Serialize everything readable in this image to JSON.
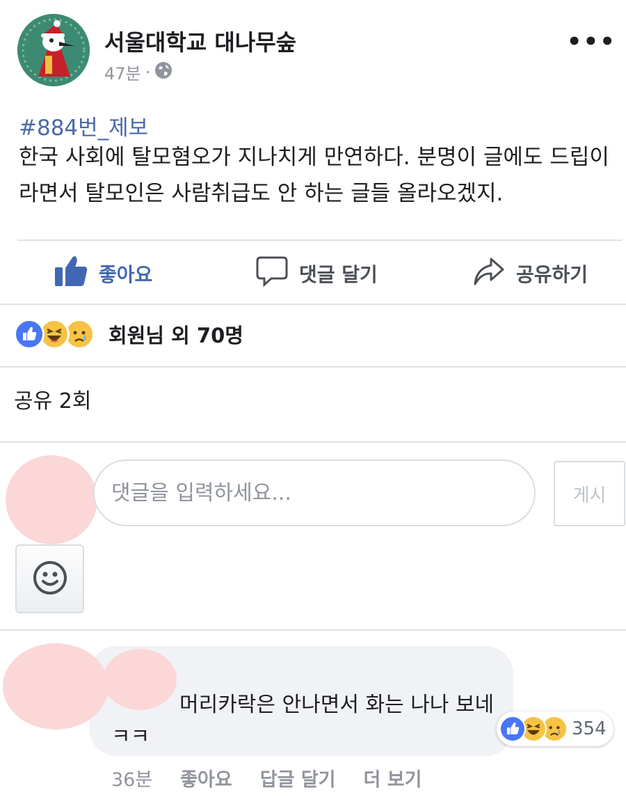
{
  "post": {
    "page_name": "서울대학교 대나무숲",
    "time": "47분",
    "separator": "·",
    "visibility_icon": "globe-icon",
    "more_icon": "more-icon",
    "more_label": "•••",
    "hashtag": "#884번_제보",
    "body": "한국 사회에 탈모혐오가 지나치게 만연하다. 분명이 글에도 드립이라면서 탈모인은 사람취급도 안 하는 글들 올라오겠지."
  },
  "actions": {
    "like_label": "좋아요",
    "comment_label": "댓글 달기",
    "share_label": "공유하기",
    "like_color": "#4267b2"
  },
  "reactions": {
    "icons": [
      "like-icon",
      "haha-icon",
      "sad-icon"
    ],
    "label": "회원님 외 70명"
  },
  "shares": {
    "label": "공유 2회"
  },
  "composer": {
    "placeholder": "댓글을 입력하세요...",
    "post_button": "게시",
    "emoji_icon": "smiley-icon"
  },
  "comment": {
    "text": "머리카락은 안나면서 화는 나나 보네ㅋㅋ",
    "reaction_icons": [
      "like-icon",
      "haha-icon",
      "sad-icon"
    ],
    "reaction_count": "354",
    "time": "36분",
    "like_label": "좋아요",
    "reply_label": "답글 달기",
    "more_label": "더 보기"
  },
  "colors": {
    "link_blue": "#4b6aa8",
    "divider": "#e0e2e6",
    "muted": "#90949c",
    "redaction": "#fbd7d8"
  }
}
